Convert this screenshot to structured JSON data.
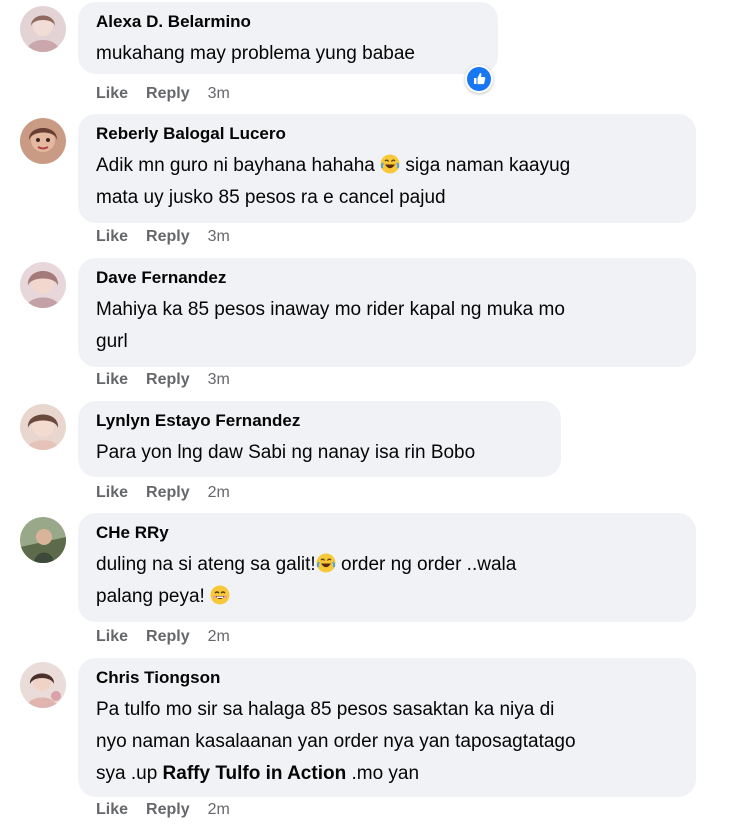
{
  "comments": [
    {
      "name": "Alexa D. Belarmino",
      "lines": [
        "mukahang may problema yung babae"
      ],
      "like": "Like",
      "reply": "Reply",
      "time": "3m",
      "avatar_color": "#d9c6c9"
    },
    {
      "name": "Reberly Balogal Lucero",
      "line1_pre": "Adik mn guro ni bayhana hahaha ",
      "line1_post": " siga naman kaayug",
      "line2": "mata uy jusko 85 pesos ra e cancel pajud",
      "like": "Like",
      "reply": "Reply",
      "time": "3m",
      "avatar_color": "#b3806c"
    },
    {
      "name": "Dave Fernandez",
      "line1": "Mahiya ka 85 pesos inaway mo rider kapal ng muka mo",
      "line2": "gurl",
      "like": "Like",
      "reply": "Reply",
      "time": "3m",
      "avatar_color": "#c7a7a9"
    },
    {
      "name": "Lynlyn Estayo Fernandez",
      "line1": "Para yon lng daw Sabi ng nanay isa rin Bobo",
      "like": "Like",
      "reply": "Reply",
      "time": "2m",
      "avatar_color": "#d6b7ac"
    },
    {
      "name": "CHe RRy",
      "line1_pre": "duling na si ateng sa galit!",
      "line1_post": " order ng order ..wala",
      "line2": "palang peya! ",
      "like": "Like",
      "reply": "Reply",
      "time": "2m",
      "avatar_color": "#7e8f6e"
    },
    {
      "name": "Chris Tiongson",
      "line1": "Pa tulfo mo sir sa halaga 85 pesos sasaktan ka niya di",
      "line2": "nyo naman kasalaanan yan order nya yan taposagtatago",
      "line3_pre": "sya .up ",
      "line3_mention": "Raffy Tulfo in Action",
      "line3_post": " .mo yan",
      "like": "Like",
      "reply": "Reply",
      "time": "2m",
      "avatar_color": "#d8c7c3"
    }
  ],
  "icons": {
    "reaction_like": "thumbs-up-icon",
    "laugh_emoji": "laughing-crying-emoji",
    "smile_emoji": "smiling-emoji"
  },
  "colors": {
    "bubble_bg": "#f0f2f5",
    "like_blue": "#1877f2",
    "meta_grey": "#65676b",
    "emoji_yellow": "#f7c93a"
  }
}
